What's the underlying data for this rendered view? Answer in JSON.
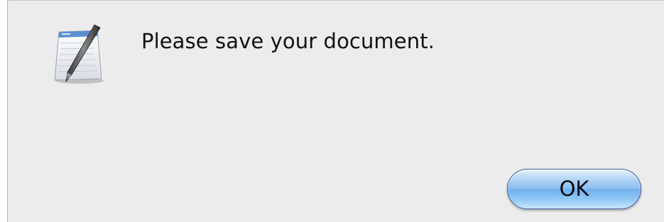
{
  "dialog": {
    "message": "Please save your document.",
    "icon": "textedit-document-pen-icon",
    "ok_label": "OK",
    "accent_color": "#8cbef0"
  }
}
